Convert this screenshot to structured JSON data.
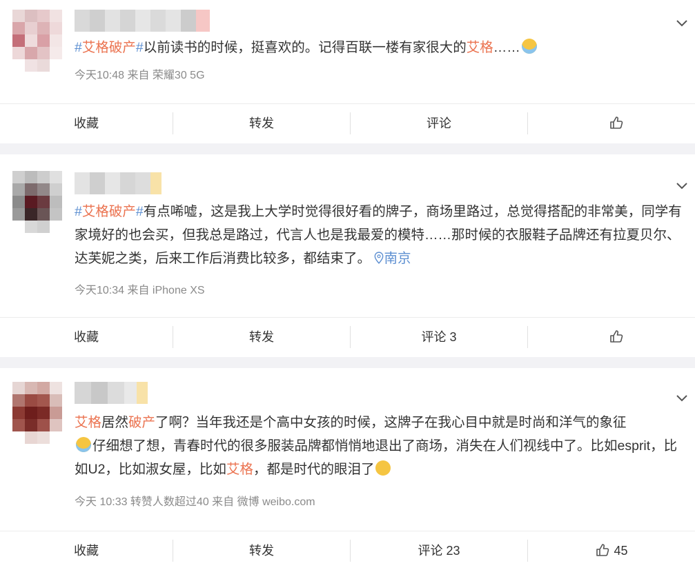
{
  "posts": [
    {
      "text_parts": [
        {
          "t": "#",
          "c": "hash"
        },
        {
          "t": "艾格破产",
          "c": "tag"
        },
        {
          "t": "#",
          "c": "hash"
        },
        {
          "t": "以前读书的时候，挺喜欢的。记得百联一楼有家很大的",
          "c": ""
        },
        {
          "t": "艾格",
          "c": "tag"
        },
        {
          "t": "……",
          "c": ""
        }
      ],
      "meta": "今天10:48 来自 荣耀30 5G",
      "actions": {
        "favorite": "收藏",
        "repost": "转发",
        "comment": "评论",
        "like_count": ""
      }
    },
    {
      "text_parts": [
        {
          "t": "#",
          "c": "hash"
        },
        {
          "t": "艾格破产",
          "c": "tag"
        },
        {
          "t": "#",
          "c": "hash"
        },
        {
          "t": "有点唏嘘，这是我上大学时觉得很好看的牌子，商场里路过，总觉得搭配的非常美，同学有家境好的也会买，但我总是路过，代言人也是我最爱的模特……那时候的衣服鞋子品牌还有拉夏贝尔、达芙妮之类，后来工作后消费比较多，都结束了。",
          "c": ""
        }
      ],
      "location": "南京",
      "meta": "今天10:34 来自 iPhone XS",
      "actions": {
        "favorite": "收藏",
        "repost": "转发",
        "comment": "评论 3",
        "like_count": ""
      }
    },
    {
      "text_parts": [
        {
          "t": "艾格",
          "c": "tag"
        },
        {
          "t": "居然",
          "c": ""
        },
        {
          "t": "破产",
          "c": "tag"
        },
        {
          "t": "了啊？当年我还是个高中女孩的时候，这牌子在我心目中就是时尚和洋气的象征",
          "c": ""
        }
      ],
      "text_parts_2": [
        {
          "t": "仔细想了想，青春时代的很多服装品牌都悄悄地退出了商场，消失在人们视线中了。比如esprit，比如U2，比如淑女屋，比如",
          "c": ""
        },
        {
          "t": "艾格",
          "c": "tag"
        },
        {
          "t": "，都是时代的眼泪了",
          "c": ""
        }
      ],
      "meta": "今天 10:33 转赞人数超过40  来自 微博 weibo.com",
      "actions": {
        "favorite": "收藏",
        "repost": "转发",
        "comment": "评论 23",
        "like_count": "45"
      }
    }
  ],
  "colors": {
    "tag": "#eb7350",
    "hash": "#5d8fd1",
    "emoji": "#f5c542"
  }
}
